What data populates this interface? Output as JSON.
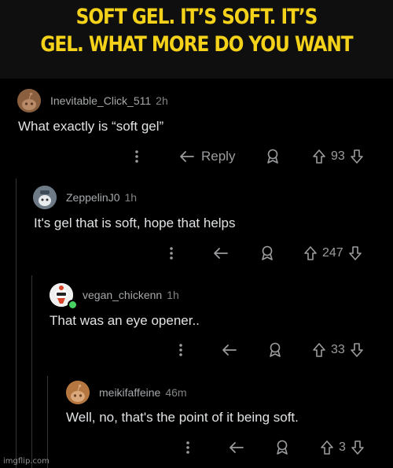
{
  "caption": {
    "line1": "SOFT GEL. IT’S SOFT. IT’S",
    "line2": "GEL. WHAT MORE DO YOU WANT",
    "color": "#f5d21a"
  },
  "comments": [
    {
      "username": "Inevitable_Click_511",
      "age": "2h",
      "body": "What exactly is “soft gel”",
      "reply_label": "Reply",
      "score": "93",
      "avatar_icon": "snoo-default-avatar-icon"
    },
    {
      "username": "ZeppelinJ0",
      "age": "1h",
      "body": "It's gel that is soft, hope that helps",
      "score": "247",
      "avatar_icon": "snoo-custom-avatar-icon"
    },
    {
      "username": "vegan_chickenn",
      "age": "1h",
      "body": "That was an eye opener..",
      "score": "33",
      "avatar_icon": "snoo-custom-avatar-icon",
      "online": true
    },
    {
      "username": "meikifaffeine",
      "age": "46m",
      "body": "Well, no, that's the point of it being soft.",
      "score": "3",
      "avatar_icon": "snoo-default-avatar-icon"
    }
  ],
  "watermark": "imgflip.com",
  "colors": {
    "background": "#000000",
    "text": "#d7dadc",
    "muted": "#818384",
    "rail": "#343536"
  }
}
